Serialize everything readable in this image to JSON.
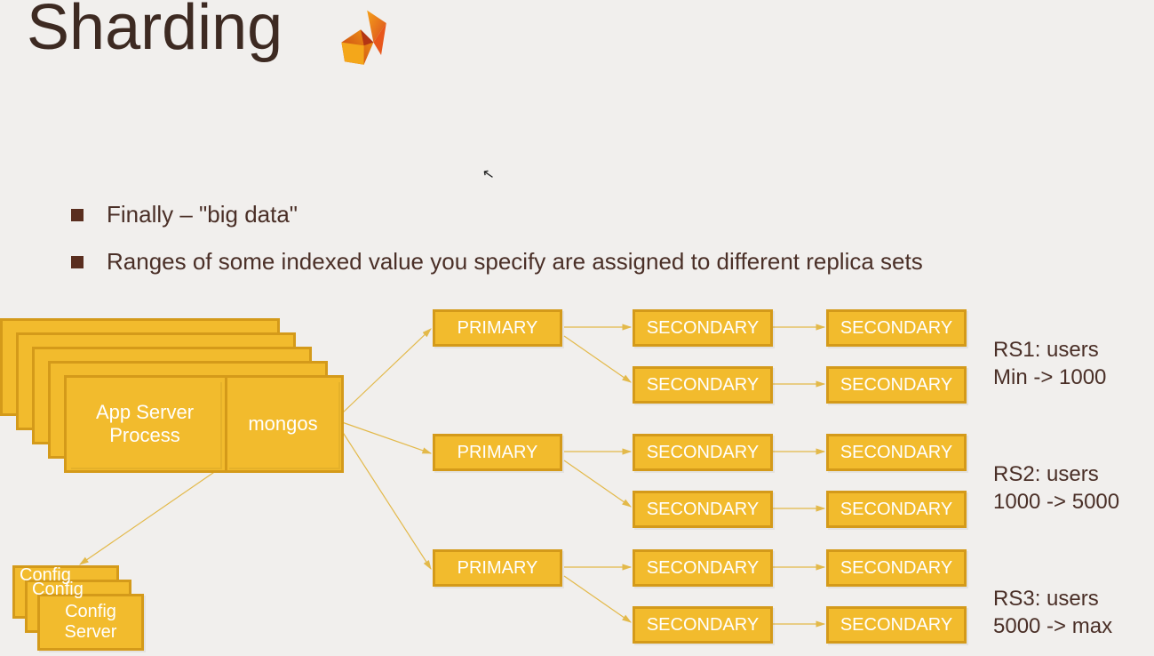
{
  "title": "Sharding",
  "bullets": [
    "Finally – \"big data\"",
    "Ranges of some indexed value you specify are assigned to different replica sets"
  ],
  "appserver": {
    "process_label": "App Server Process",
    "mongos_label": "mongos"
  },
  "config_server": {
    "label_short": "Config",
    "label": "Config Server"
  },
  "replica_sets": [
    {
      "primary": "PRIMARY",
      "secondaries_row1": [
        "SECONDARY",
        "SECONDARY"
      ],
      "secondaries_row2": [
        "SECONDARY",
        "SECONDARY"
      ],
      "annotation_line1": "RS1: users",
      "annotation_line2": "Min -> 1000"
    },
    {
      "primary": "PRIMARY",
      "secondaries_row1": [
        "SECONDARY",
        "SECONDARY"
      ],
      "secondaries_row2": [
        "SECONDARY",
        "SECONDARY"
      ],
      "annotation_line1": "RS2: users",
      "annotation_line2": "1000 -> 5000"
    },
    {
      "primary": "PRIMARY",
      "secondaries_row1": [
        "SECONDARY",
        "SECONDARY"
      ],
      "secondaries_row2": [
        "SECONDARY",
        "SECONDARY"
      ],
      "annotation_line1": "RS3: users",
      "annotation_line2": "5000 -> max"
    }
  ],
  "colors": {
    "box_fill": "#f2bb2d",
    "box_border": "#d49a1a",
    "text_dark": "#4a2f27",
    "bg": "#f1efed"
  }
}
